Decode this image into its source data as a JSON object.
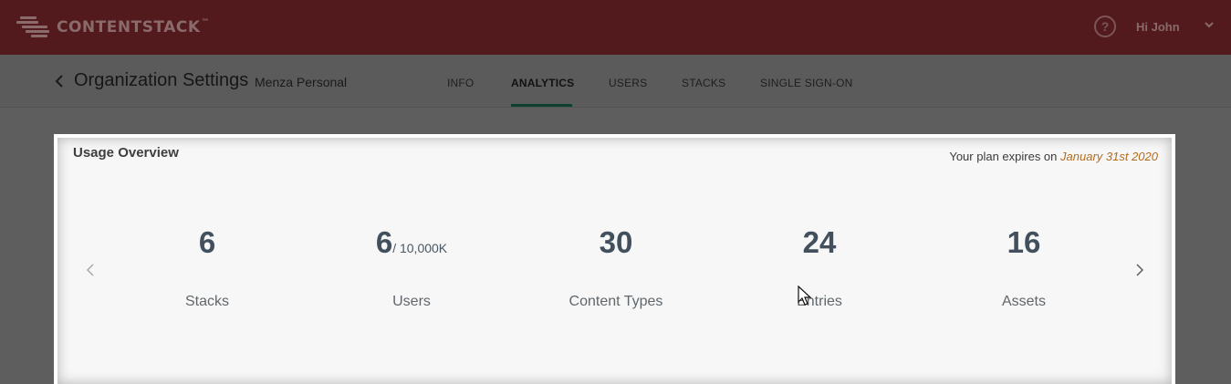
{
  "header": {
    "logo_text": "CONTENTSTACK",
    "logo_tm": "™",
    "help_label": "?",
    "greeting": "Hi John",
    "icons": [
      "logo-icon",
      "help-icon",
      "chevron-down-icon"
    ]
  },
  "subheader": {
    "title": "Organization Settings",
    "org_name": "Menza Personal",
    "tabs": [
      {
        "label": "INFO",
        "active": false
      },
      {
        "label": "ANALYTICS",
        "active": true
      },
      {
        "label": "USERS",
        "active": false
      },
      {
        "label": "STACKS",
        "active": false
      },
      {
        "label": "SINGLE SIGN-ON",
        "active": false
      }
    ]
  },
  "usage": {
    "title": "Usage Overview",
    "plan_prefix": "Your plan expires on",
    "plan_date": "January 31st 2020",
    "stats": [
      {
        "value": "6",
        "suffix": "",
        "label": "Stacks"
      },
      {
        "value": "6",
        "suffix": "/ 10,000K",
        "label": "Users"
      },
      {
        "value": "30",
        "suffix": "",
        "label": "Content Types"
      },
      {
        "value": "24",
        "suffix": "",
        "label": "Entries"
      },
      {
        "value": "16",
        "suffix": "",
        "label": "Assets"
      }
    ]
  },
  "colors": {
    "header_bg": "#521a1d",
    "tab_active_underline": "#0e4032",
    "plan_date": "#b56b1e",
    "stat_number": "#41505c"
  }
}
